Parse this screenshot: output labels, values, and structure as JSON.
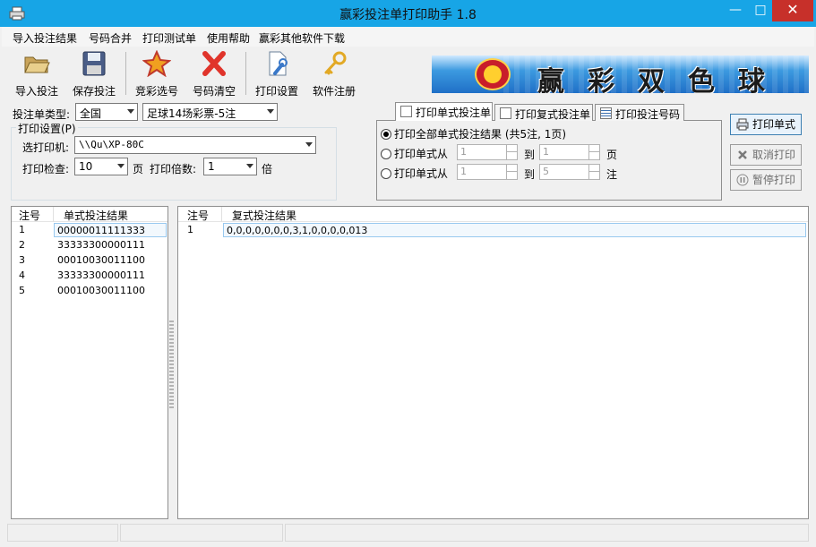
{
  "window": {
    "title": "赢彩投注单打印助手 1.8",
    "controls": {
      "minimize": "—",
      "maximize": "□",
      "close": "✕"
    }
  },
  "menu": [
    {
      "label": "导入投注结果"
    },
    {
      "label": "号码合并"
    },
    {
      "label": "打印测试单"
    },
    {
      "label": "使用帮助"
    },
    {
      "label": "赢彩其他软件下载"
    }
  ],
  "toolbar": {
    "buttons": [
      {
        "label": "导入投注",
        "icon": "folder-open-icon"
      },
      {
        "label": "保存投注",
        "icon": "floppy-disk-icon"
      },
      {
        "label": "竞彩选号",
        "icon": "star-icon"
      },
      {
        "label": "号码清空",
        "icon": "red-x-icon"
      },
      {
        "label": "打印设置",
        "icon": "document-wrench-icon"
      },
      {
        "label": "软件注册",
        "icon": "key-icon"
      }
    ],
    "banner_text": "赢彩双色球"
  },
  "form": {
    "bet_type_label": "投注单类型:",
    "bet_type_value": "全国",
    "lottery_value": "足球14场彩票-5注",
    "print_settings_title": "打印设置(P)",
    "printer_label": "选打印机:",
    "printer_value": "\\\\Qu\\XP-80C",
    "check_label": "打印检查:",
    "check_value": "10",
    "page_unit": "页",
    "multiple_label": "打印倍数:",
    "multiple_value": "1",
    "multiple_unit": "倍"
  },
  "tabs": [
    {
      "label": "打印单式投注单"
    },
    {
      "label": "打印复式投注单"
    },
    {
      "label": "打印投注号码"
    }
  ],
  "print_options": {
    "all_label": "打印全部单式投注结果 (共5注, 1页)",
    "range_page_label": "打印单式从",
    "range_page_from": "1",
    "range_page_to": "1",
    "range_page_unit": "页",
    "to_label": "到",
    "range_bet_label": "打印单式从",
    "range_bet_from": "1",
    "range_bet_to": "5",
    "range_bet_unit": "注"
  },
  "side_buttons": {
    "print": "打印单式",
    "cancel": "取消打印",
    "pause": "暂停打印"
  },
  "single_list": {
    "headers": [
      "注号",
      "单式投注结果"
    ],
    "rows": [
      {
        "no": "1",
        "result": "00000011111333"
      },
      {
        "no": "2",
        "result": "33333300000111"
      },
      {
        "no": "3",
        "result": "00010030011100"
      },
      {
        "no": "4",
        "result": "33333300000111"
      },
      {
        "no": "5",
        "result": "00010030011100"
      }
    ]
  },
  "compound_list": {
    "headers": [
      "注号",
      "复式投注结果"
    ],
    "rows": [
      {
        "no": "1",
        "result": "0,0,0,0,0,0,0,3,1,0,0,0,0,013"
      }
    ]
  },
  "colors": {
    "titlebar": "#17a5e6",
    "close_button": "#c7302a",
    "window_bg": "#f0f0f0",
    "selection_border": "#99c9ef"
  }
}
